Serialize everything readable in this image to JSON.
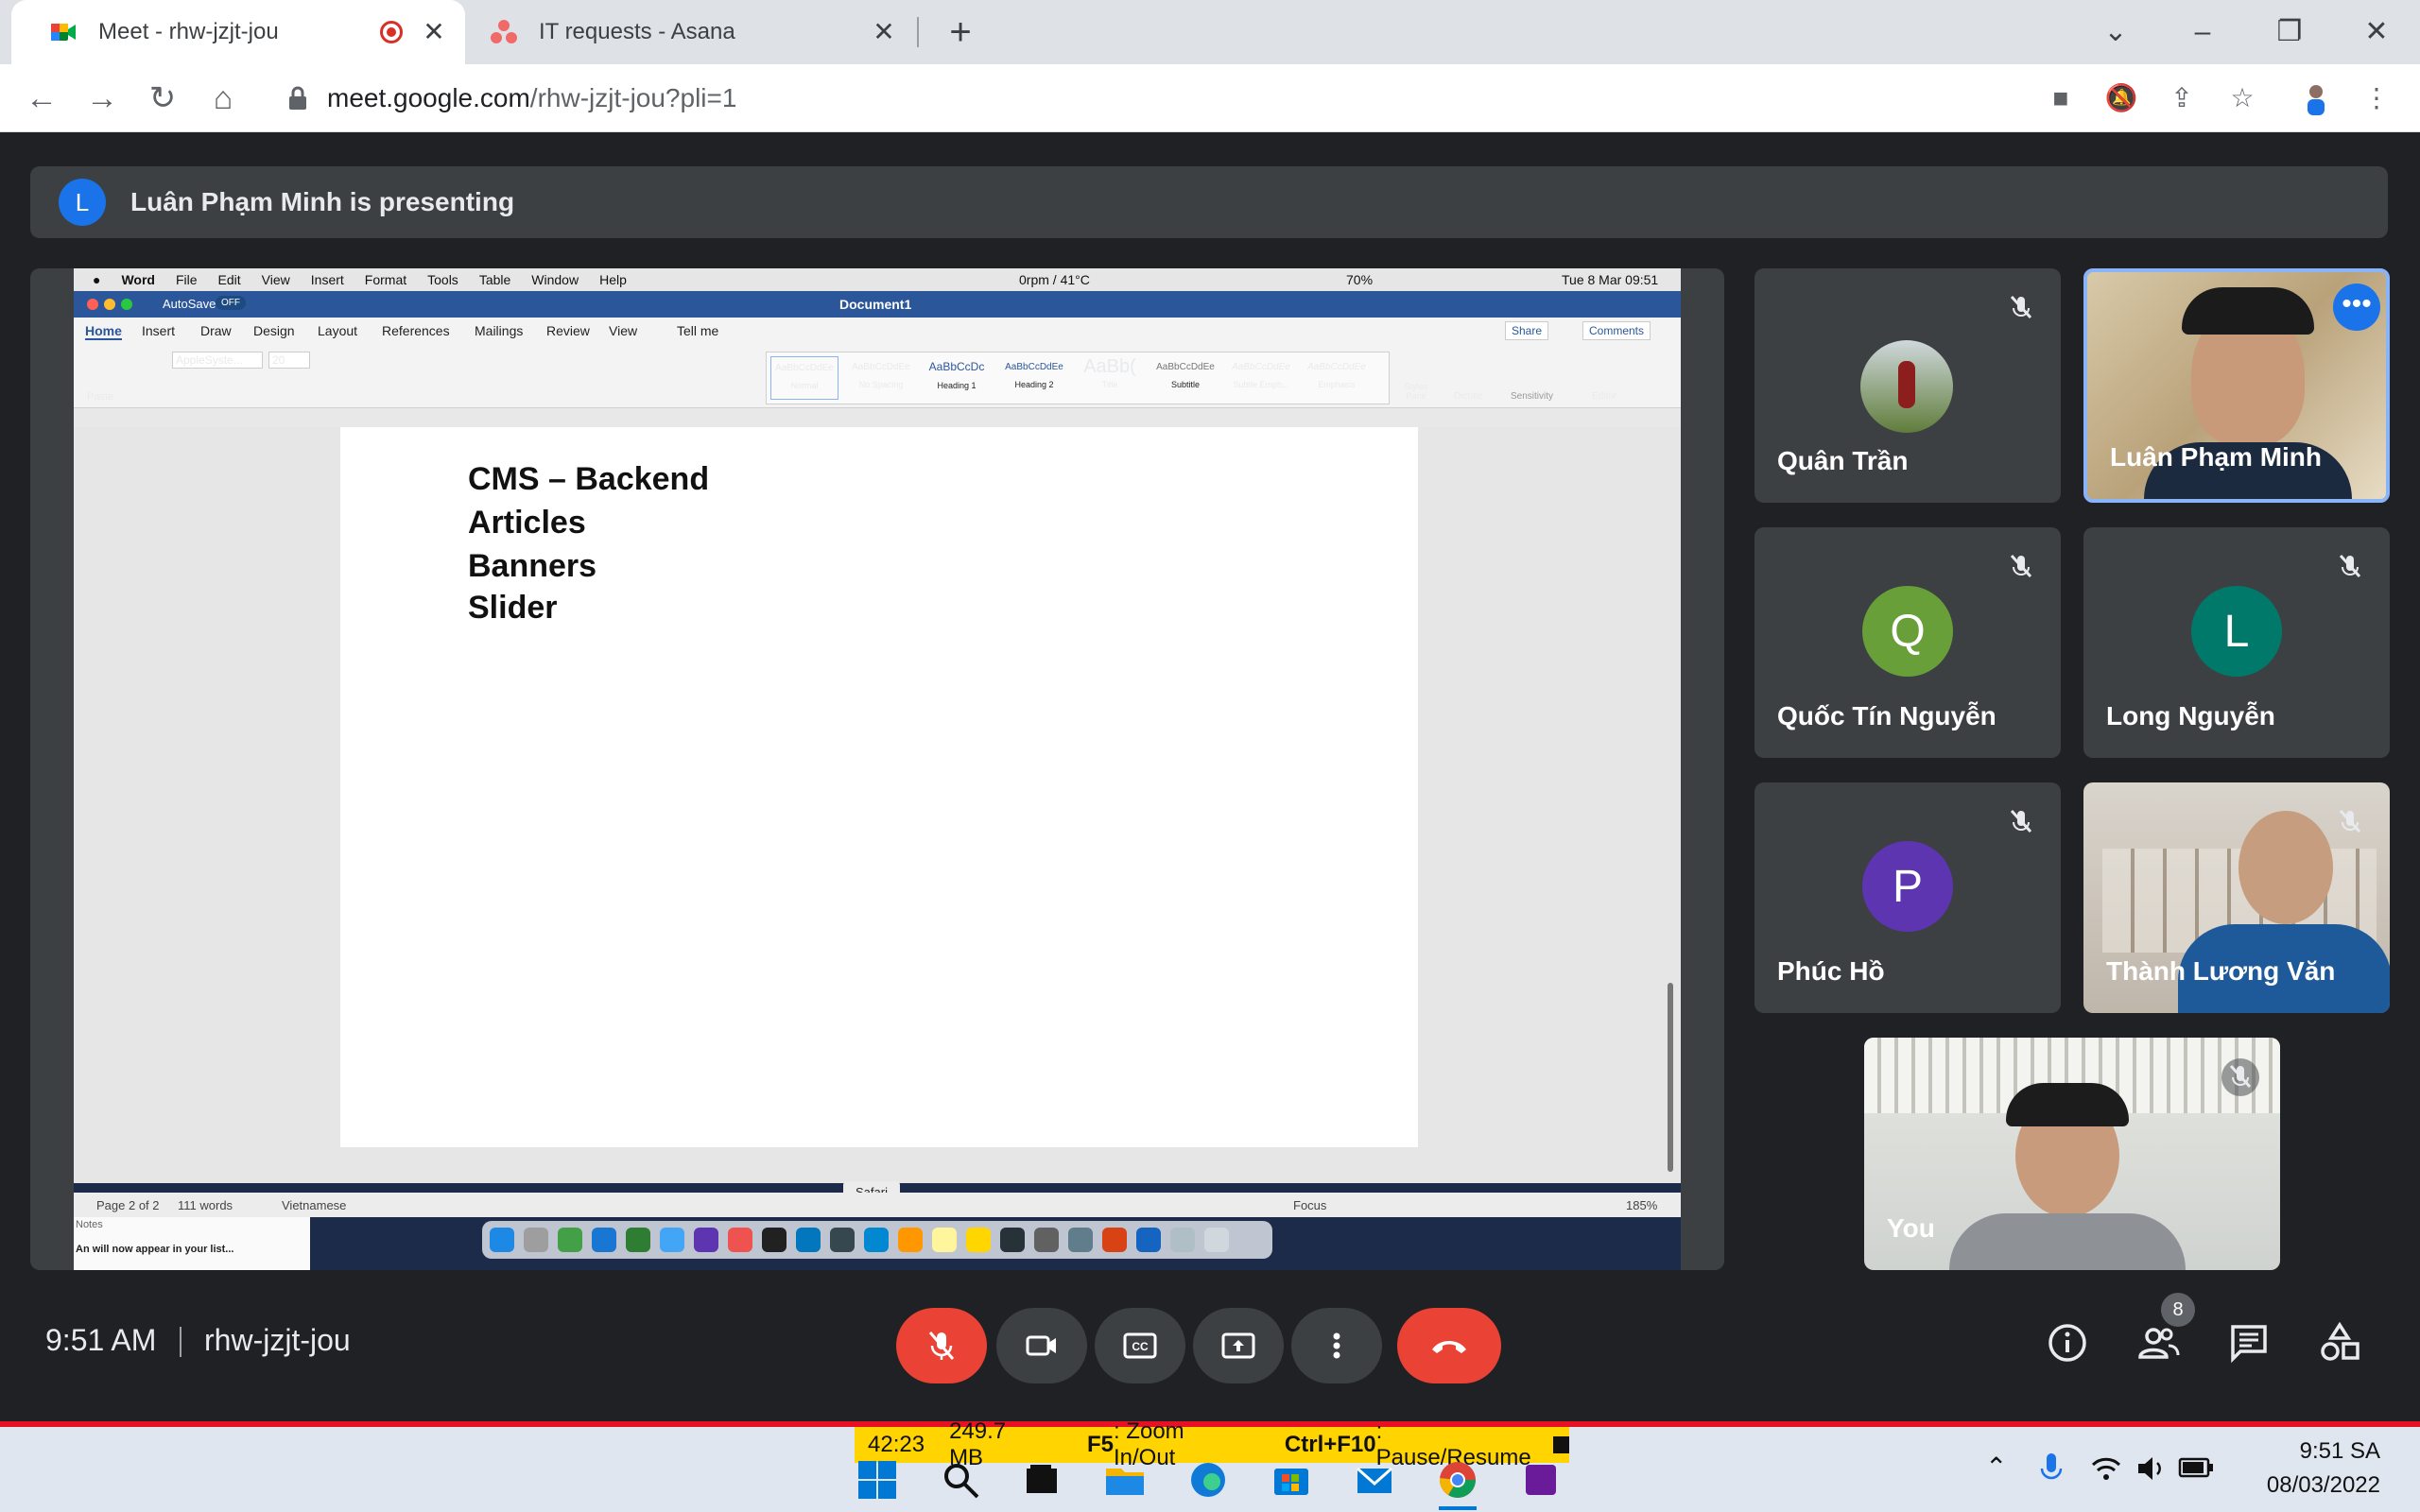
{
  "browser": {
    "tabs": [
      {
        "title": "Meet - rhw-jzjt-jou",
        "active": true,
        "recording": true
      },
      {
        "title": "IT requests - Asana",
        "active": false
      }
    ],
    "url_host": "meet.google.com",
    "url_path": "/rhw-jzjt-jou?pli=1"
  },
  "meet": {
    "presenting_banner": "Luân Phạm Minh is presenting",
    "presenter_initial": "L",
    "time": "9:51 AM",
    "meeting_code": "rhw-jzjt-jou",
    "people_count": "8",
    "participants": [
      {
        "name": "Quân Trần",
        "muted": true,
        "type": "photo-avatar"
      },
      {
        "name": "Luân Phạm Minh",
        "muted": false,
        "type": "video",
        "speaking": true
      },
      {
        "name": "Quốc Tín Nguyễn",
        "muted": true,
        "type": "letter",
        "letter": "Q",
        "color": "#689f38"
      },
      {
        "name": "Long Nguyễn",
        "muted": true,
        "type": "letter",
        "letter": "L",
        "color": "#00796b"
      },
      {
        "name": "Phúc Hồ",
        "muted": true,
        "type": "letter",
        "letter": "P",
        "color": "#5e35b1"
      },
      {
        "name": "Thành Lương Văn",
        "muted": true,
        "type": "video"
      },
      {
        "name": "You",
        "muted": true,
        "type": "video"
      }
    ]
  },
  "shared_screen": {
    "mac_menu": [
      "Word",
      "File",
      "Edit",
      "View",
      "Insert",
      "Format",
      "Tools",
      "Table",
      "Window",
      "Help"
    ],
    "mac_status": "0rpm / 41°C",
    "mac_battery": "70%",
    "mac_datetime": "Tue 8 Mar 09:51",
    "autosave": "AutoSave",
    "autosave_state": "OFF",
    "doc_title": "Document1",
    "ribbon_tabs": [
      "Home",
      "Insert",
      "Draw",
      "Design",
      "Layout",
      "References",
      "Mailings",
      "Review",
      "View",
      "Tell me"
    ],
    "share_label": "Share",
    "comments_label": "Comments",
    "font_name": "AppleSyste...",
    "font_size": "20",
    "paste_label": "Paste",
    "styles": [
      {
        "preview": "AaBbCcDdEe",
        "label": "Normal"
      },
      {
        "preview": "AaBbCcDdEe",
        "label": "No Spacing"
      },
      {
        "preview": "AaBbCcDc",
        "label": "Heading 1"
      },
      {
        "preview": "AaBbCcDdEe",
        "label": "Heading 2"
      },
      {
        "preview": "AaBb(",
        "label": "Title"
      },
      {
        "preview": "AaBbCcDdEe",
        "label": "Subtitle"
      },
      {
        "preview": "AaBbCcDdEe",
        "label": "Subtle Emph..."
      },
      {
        "preview": "AaBbCcDdEe",
        "label": "Emphasis"
      }
    ],
    "styles_pane": "Styles Pane",
    "dictate": "Dictate",
    "sensitivity": "Sensitivity",
    "editor": "Editor",
    "doc_lines": [
      "CMS – Backend",
      "Articles",
      "Banners",
      "Slider"
    ],
    "status_page": "Page 2 of 2",
    "status_words": "111 words",
    "status_lang": "Vietnamese",
    "status_focus": "Focus",
    "status_zoom": "185%",
    "dock_tooltip": "Safari",
    "notes_label": "Notes",
    "notes_text": "An will now appear in your list..."
  },
  "taskbar": {
    "recorder_time": "42:23",
    "recorder_size": "249.7 MB",
    "hint1_key": "F5",
    "hint1_text": ": Zoom In/Out",
    "hint2_key": "Ctrl+F10",
    "hint2_text": ": Pause/Resume",
    "clock_time": "9:51 SA",
    "clock_date": "08/03/2022"
  }
}
